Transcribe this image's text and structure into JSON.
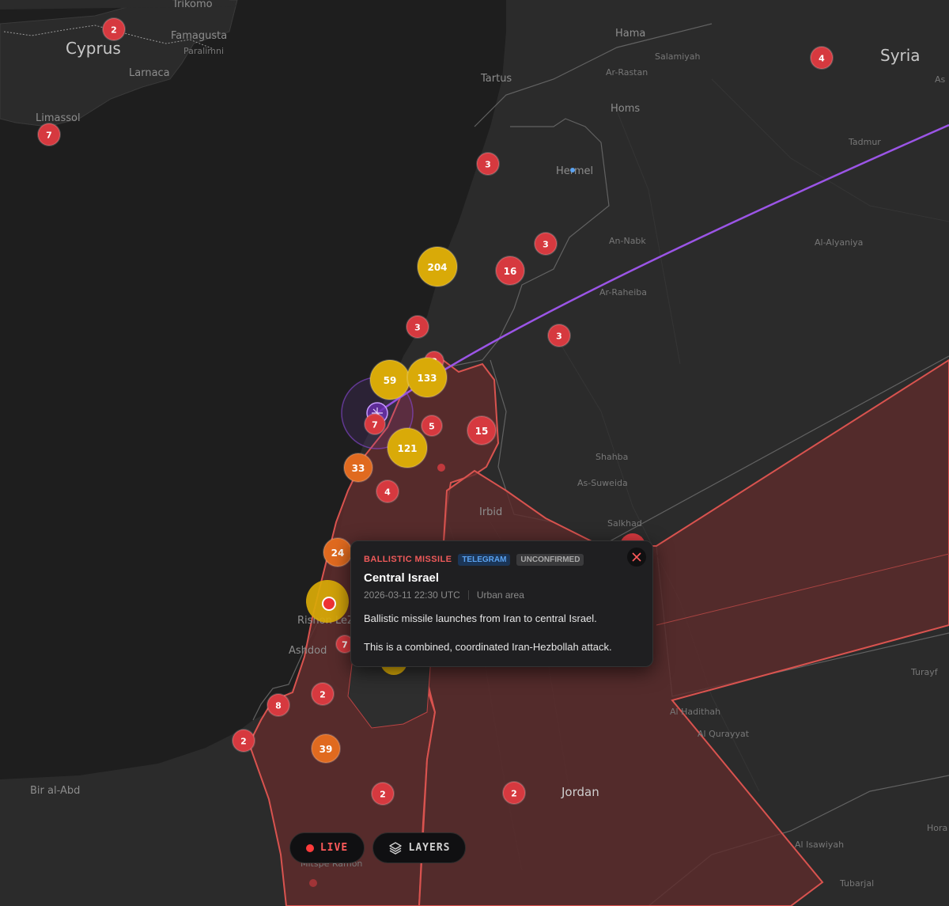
{
  "colors": {
    "land": "#2b2b2b",
    "sea": "#1e1e1e",
    "border": "#5f5f5f",
    "zone_fill": "#5e2c2c",
    "zone_stroke": "#d9534f",
    "trajectory": "#9b55e6",
    "cluster_red": "#d6393f",
    "cluster_orange": "#e06a1f",
    "cluster_yellow": "#d9aa08",
    "accent_live": "#ff3b3b"
  },
  "places": {
    "country": [
      "Cyprus",
      "Syria",
      "Jordan"
    ],
    "cities": [
      "Trikomo",
      "Famagusta",
      "Paralimni",
      "Larnaca",
      "Limassol",
      "Hama",
      "Salamiyah",
      "Tartus",
      "Ar-Rastan",
      "Homs",
      "Hermel",
      "Tadmur",
      "An-Nabk",
      "Al-Alyaniya",
      "Ar-Raheiba",
      "Shahba",
      "As-Suweida",
      "Irbid",
      "Salkhad",
      "Ashdod",
      "Rishon LeZ",
      "Turayf",
      "Al Hadithah",
      "Al Qurayyat",
      "Bir al-Abd",
      "Al Isawiyah",
      "Tubarjal",
      "Hora",
      "As",
      "Mitspe Ramon"
    ]
  },
  "clusters": [
    {
      "label": "2",
      "kind": "red"
    },
    {
      "label": "7",
      "kind": "red"
    },
    {
      "label": "4",
      "kind": "red"
    },
    {
      "label": "3",
      "kind": "red"
    },
    {
      "label": "3",
      "kind": "red"
    },
    {
      "label": "16",
      "kind": "red"
    },
    {
      "label": "204",
      "kind": "yellow"
    },
    {
      "label": "3",
      "kind": "red"
    },
    {
      "label": "3",
      "kind": "red"
    },
    {
      "label": "8",
      "kind": "red"
    },
    {
      "label": "59",
      "kind": "yellow"
    },
    {
      "label": "133",
      "kind": "yellow"
    },
    {
      "label": "7",
      "kind": "red"
    },
    {
      "label": "5",
      "kind": "red"
    },
    {
      "label": "15",
      "kind": "red"
    },
    {
      "label": "121",
      "kind": "yellow"
    },
    {
      "label": "33",
      "kind": "orange"
    },
    {
      "label": "4",
      "kind": "red"
    },
    {
      "label": "24",
      "kind": "orange"
    },
    {
      "label": "7",
      "kind": "red"
    },
    {
      "label": "2",
      "kind": "red"
    },
    {
      "label": "8",
      "kind": "red"
    },
    {
      "label": "2",
      "kind": "red"
    },
    {
      "label": "39",
      "kind": "orange"
    },
    {
      "label": "2",
      "kind": "red"
    },
    {
      "label": "2",
      "kind": "red"
    }
  ],
  "popup": {
    "type": "BALLISTIC MISSILE",
    "source": "TELEGRAM",
    "status": "UNCONFIRMED",
    "title": "Central Israel",
    "timestamp": "2026-03-11 22:30 UTC",
    "area": "Urban area",
    "description": [
      "Ballistic missile launches from Iran to central Israel.",
      "This is a combined, coordinated Iran-Hezbollah attack."
    ],
    "close_icon": "close-icon"
  },
  "controls": {
    "live_label": "LIVE",
    "layers_label": "LAYERS",
    "layers_icon": "layers-icon"
  }
}
